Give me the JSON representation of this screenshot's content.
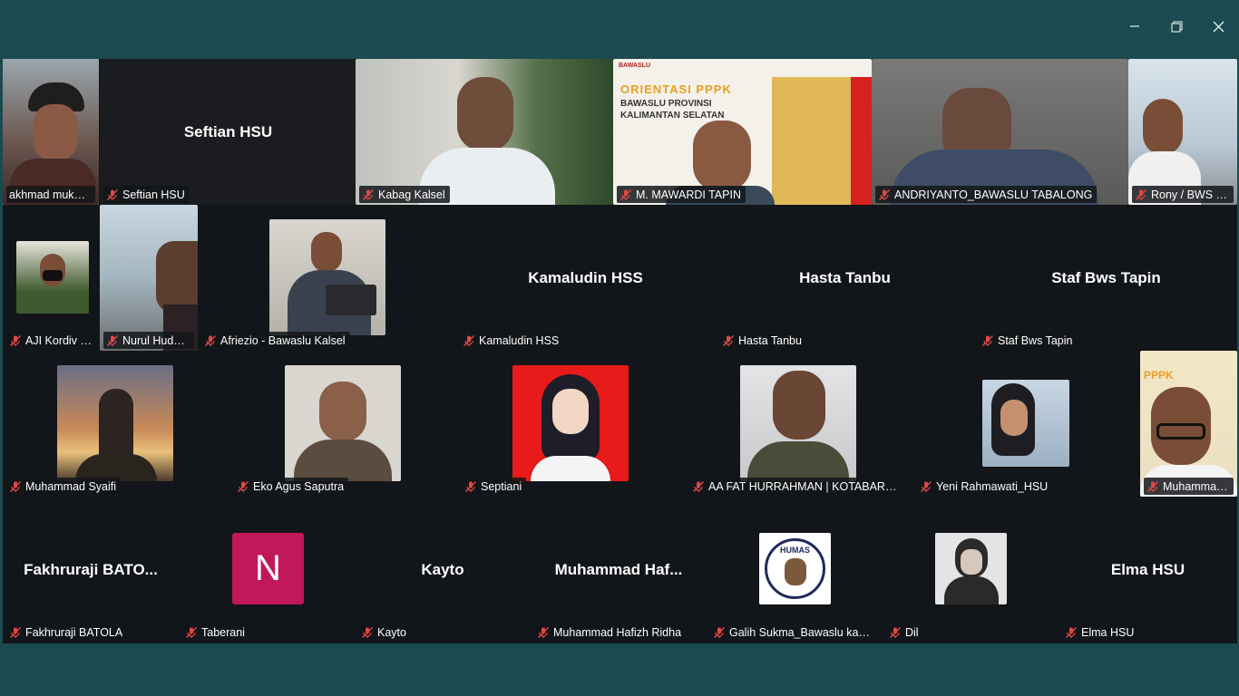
{
  "window_controls": {
    "minimize": "minimize",
    "restore": "restore",
    "close": "close"
  },
  "participants": [
    {
      "label": "akhmad mukhli...",
      "center": ""
    },
    {
      "label": "Seftian HSU",
      "center": "Seftian HSU"
    },
    {
      "label": "Kabag Kalsel",
      "center": ""
    },
    {
      "label": "M. MAWARDI  TAPIN",
      "center": ""
    },
    {
      "label": "ANDRIYANTO_BAWASLU TABALONG",
      "center": ""
    },
    {
      "label": "Rony / BWS K...",
      "center": ""
    },
    {
      "label": "AJI Kordiv P...",
      "center": ""
    },
    {
      "label": "Nurul Huda_...",
      "center": ""
    },
    {
      "label": "Afriezio - Bawaslu Kalsel",
      "center": ""
    },
    {
      "label": "Kamaludin HSS",
      "center": "Kamaludin HSS"
    },
    {
      "label": "Hasta Tanbu",
      "center": "Hasta Tanbu"
    },
    {
      "label": "Staf Bws Tapin",
      "center": "Staf Bws Tapin"
    },
    {
      "label": "Muhammad Syaifi",
      "center": ""
    },
    {
      "label": "Eko Agus Saputra",
      "center": ""
    },
    {
      "label": "Septiani",
      "center": ""
    },
    {
      "label": "AA FAT HURRAHMAN | KOTABARU | 2...",
      "center": ""
    },
    {
      "label": "Yeni Rahmawati_HSU",
      "center": ""
    },
    {
      "label": "Muhammad...",
      "center": ""
    },
    {
      "label": "Fakhruraji BATOLA",
      "center": "Fakhruraji  BATO..."
    },
    {
      "label": "Taberani",
      "center": "",
      "letter": "N"
    },
    {
      "label": "Kayto",
      "center": "Kayto"
    },
    {
      "label": "Muhammad Hafizh Ridha",
      "center": "Muhammad  Haf..."
    },
    {
      "label": "Galih Sukma_Bawaslu kab. ...",
      "center": ""
    },
    {
      "label": "Dil",
      "center": ""
    },
    {
      "label": "Elma HSU",
      "center": "Elma HSU"
    }
  ],
  "banner": {
    "line1": "ORIENTASI PPPK",
    "line2": "BAWASLU PROVINSI",
    "line3": "KALIMANTAN SELATAN",
    "logo": "BAWASLU"
  },
  "humas_logo": "HUMAS",
  "colors": {
    "background": "#1b4a50",
    "grid": "#121519",
    "active_speaker": "#4dd97a",
    "mic_muted": "#e04848"
  }
}
